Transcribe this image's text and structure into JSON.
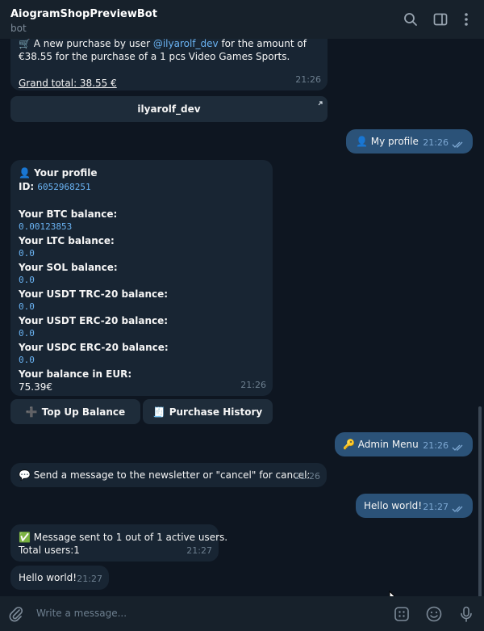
{
  "header": {
    "title": "AiogramShopPreviewBot",
    "subtitle": "bot"
  },
  "messages": {
    "purchase": {
      "line1_prefix": "A new purchase by user ",
      "user_link": "@ilyarolf_dev",
      "line1_suffix": " for the amount of",
      "line2": "€38.55 for the purchase of a 1 pcs Video Games Sports.",
      "grand_total": "Grand total: 38.55 €",
      "time": "21:26",
      "button": "ilyarolf_dev"
    },
    "my_profile": {
      "text": "My profile",
      "time": "21:26"
    },
    "profile": {
      "title": "Your profile",
      "id_label": "ID: ",
      "id_value": "6052968251",
      "btc_label": "Your BTC balance:",
      "btc_value": "0.00123853",
      "ltc_label": "Your LTC balance:",
      "ltc_value": "0.0",
      "sol_label": "Your SOL balance:",
      "sol_value": "0.0",
      "usdt_trc_label": "Your USDT TRC-20 balance:",
      "usdt_trc_value": "0.0",
      "usdt_erc_label": "Your USDT ERC-20 balance:",
      "usdt_erc_value": "0.0",
      "usdc_erc_label": "Your USDC ERC-20 balance:",
      "usdc_erc_value": "0.0",
      "eur_label": "Your balance in EUR:",
      "eur_value": "75.39€",
      "time": "21:26",
      "btn_topup": "Top Up Balance",
      "btn_history": "Purchase History"
    },
    "admin_menu": {
      "text": "Admin Menu",
      "time": "21:26"
    },
    "newsletter_prompt": {
      "text": "Send a message to the newsletter or \"cancel\" for cancel:",
      "time": "21:26"
    },
    "hello_out": {
      "text": "Hello world!",
      "time": "21:27"
    },
    "sent": {
      "line1": "Message sent to 1 out of 1 active users.",
      "line2": "Total users:1",
      "time": "21:27"
    },
    "hello_in": {
      "text": "Hello world!",
      "time": "21:27"
    }
  },
  "composer": {
    "placeholder": "Write a message..."
  }
}
